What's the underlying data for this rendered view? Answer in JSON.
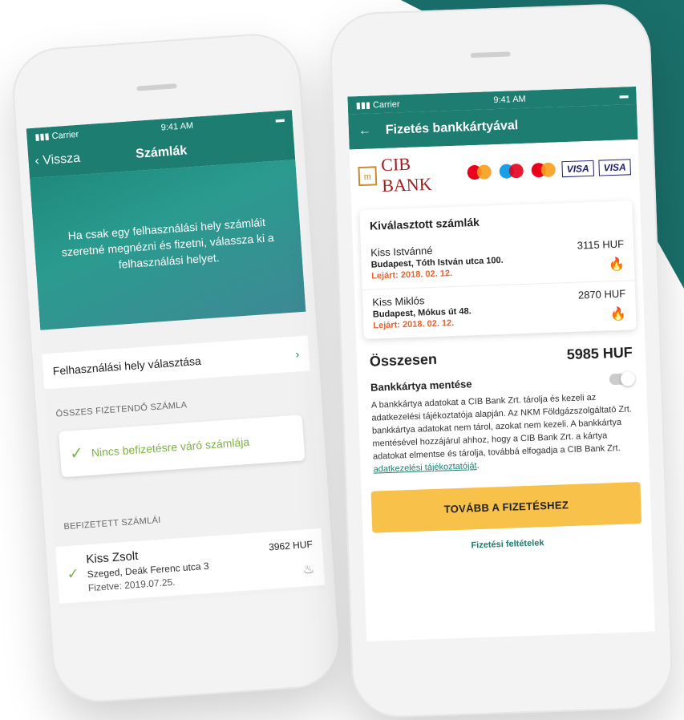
{
  "left": {
    "status": {
      "carrier": "Carrier",
      "time": "9:41 AM"
    },
    "nav": {
      "back": "Vissza",
      "title": "Számlák"
    },
    "hero_text": "Ha csak egy felhasználási hely számláit szeretné megnézni és fizetni, válassza ki a felhasználási helyet.",
    "place_select": "Felhasználási hely választása",
    "due_section": "ÖSSZES FIZETENDŐ SZÁMLA",
    "no_due": "Nincs befizetésre váró számlája",
    "paid_section": "BEFIZETETT SZÁMLÁI",
    "paid": {
      "name": "Kiss Zsolt",
      "address": "Szeged, Deák Ferenc utca 3",
      "paid_label": "Fizetve:",
      "paid_date": "2019.07.25.",
      "amount": "3962 HUF"
    }
  },
  "right": {
    "status": {
      "carrier": "Carrier",
      "time": "9:41 AM"
    },
    "nav": {
      "title": "Fizetés bankkártyával"
    },
    "bank": {
      "name": "CIB BANK",
      "visa1": "VISA",
      "visa2": "VISA"
    },
    "selected_header": "Kiválasztott számlák",
    "bills": [
      {
        "name": "Kiss Istvánné",
        "address": "Budapest, Tóth István utca 100.",
        "due": "Lejárt: 2018. 02. 12.",
        "amount": "3115 HUF"
      },
      {
        "name": "Kiss Miklós",
        "address": "Budapest, Mókus út 48.",
        "due": "Lejárt: 2018. 02. 12.",
        "amount": "2870 HUF"
      }
    ],
    "total_label": "Összesen",
    "total_value": "5985 HUF",
    "save_card": "Bankkártya mentése",
    "legal_text": "A bankkártya adatokat a CIB Bank Zrt. tárolja és kezeli az adatkezelési tájékoztatója alapján. Az NKM Földgázszolgáltató Zrt. bankkártya adatokat nem tárol, azokat nem kezeli. A bankkártya mentésével hozzájárul ahhoz, hogy a CIB Bank Zrt. a kártya adatokat elmentse és tárolja, továbbá elfogadja a CIB Bank Zrt.",
    "legal_link": "adatkezelési tájékoztatóját",
    "pay_button": "TOVÁBB A FIZETÉSHEZ",
    "terms": "Fizetési feltételek"
  },
  "colors": {
    "teal": "#1c7d70",
    "accent": "#f7c14a",
    "overdue": "#e8622b",
    "ok": "#7cb342"
  }
}
